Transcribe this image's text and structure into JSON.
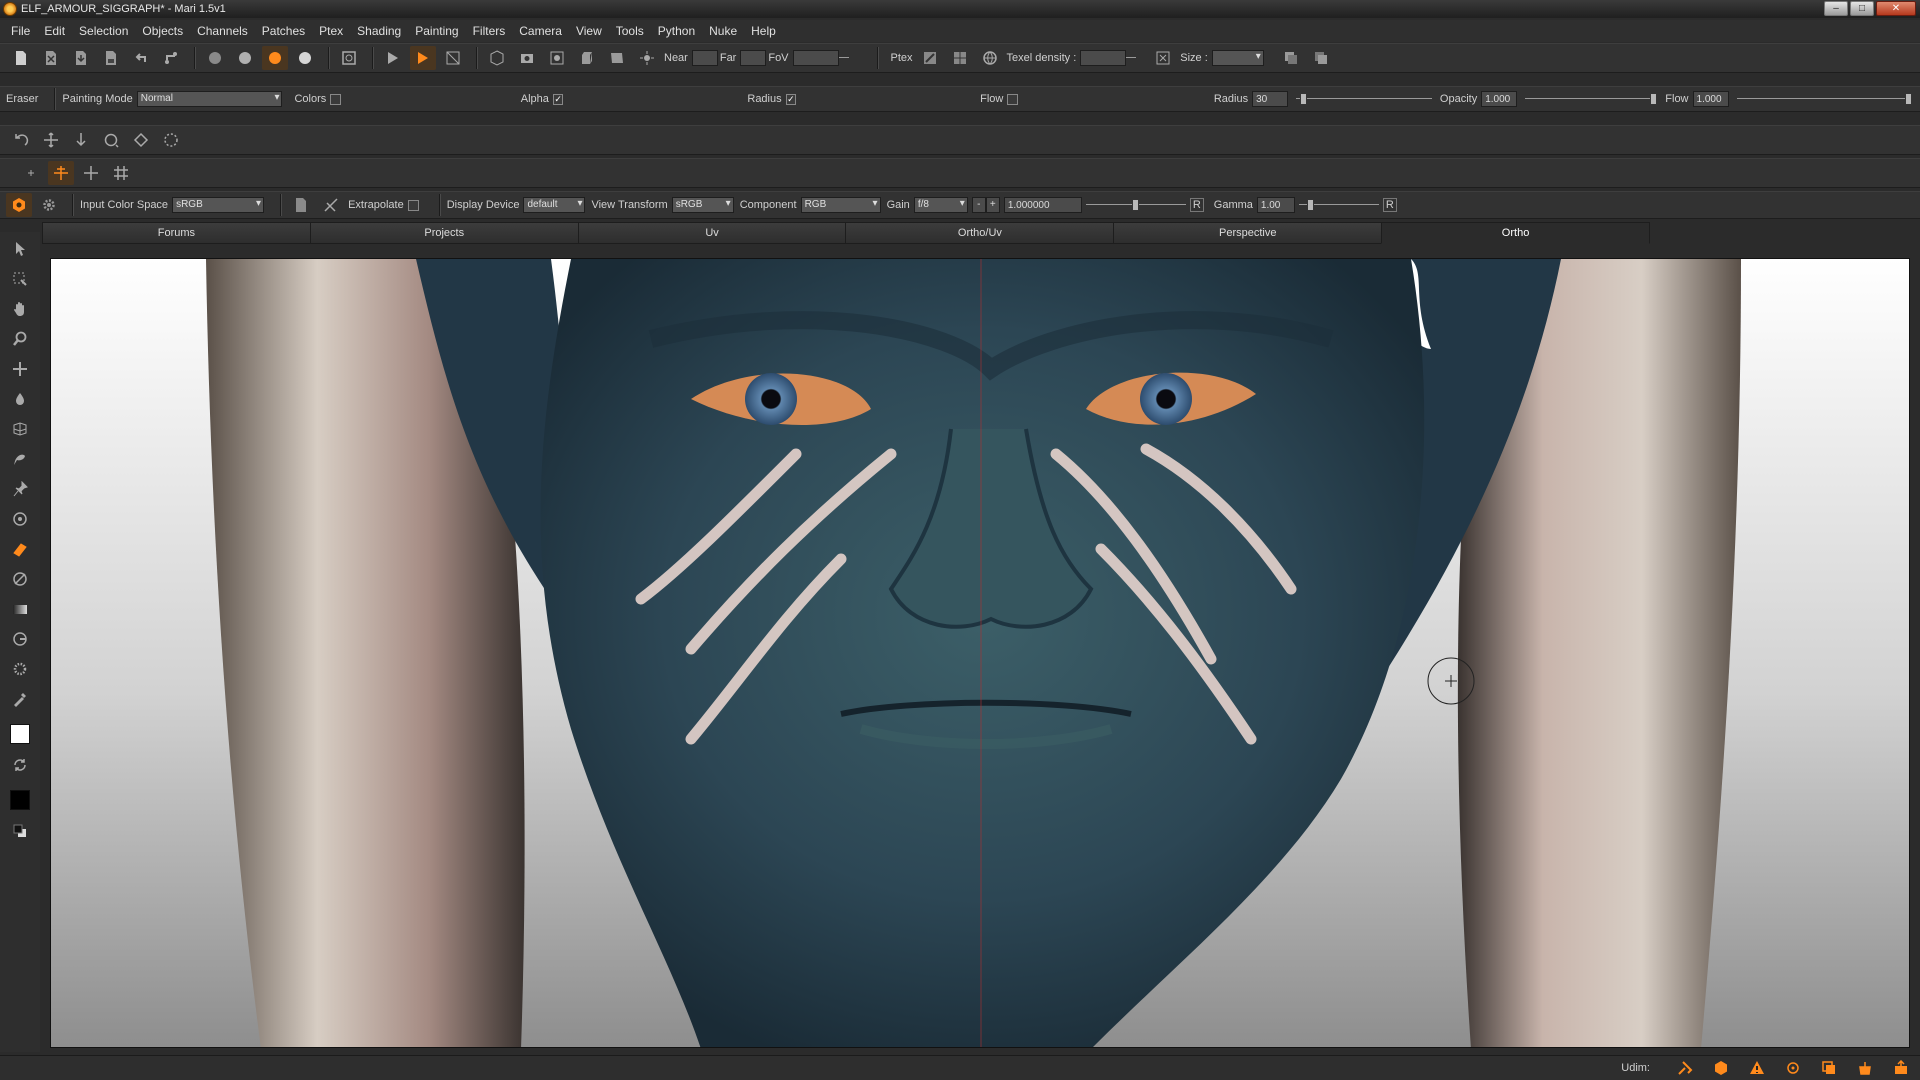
{
  "window": {
    "title": "ELF_ARMOUR_SIGGRAPH* - Mari 1.5v1",
    "min": "‒",
    "max": "□",
    "close": "✕"
  },
  "menu": [
    "File",
    "Edit",
    "Selection",
    "Objects",
    "Channels",
    "Patches",
    "Ptex",
    "Shading",
    "Painting",
    "Filters",
    "Camera",
    "View",
    "Tools",
    "Python",
    "Nuke",
    "Help"
  ],
  "camera": {
    "near_label": "Near",
    "far_label": "Far",
    "fov_label": "FoV"
  },
  "ptex": {
    "label": "Ptex",
    "texel_density_label": "Texel density :",
    "size_label": "Size :"
  },
  "brush": {
    "tool_label": "Eraser",
    "painting_mode_label": "Painting Mode",
    "painting_mode_value": "Normal",
    "colors_label": "Colors",
    "alpha_label": "Alpha",
    "radius_check_label": "Radius",
    "flow_check_label": "Flow",
    "radius_label": "Radius",
    "radius_value": "30",
    "opacity_label": "Opacity",
    "opacity_value": "1.000",
    "flow_label": "Flow",
    "flow_value": "1.000"
  },
  "color": {
    "input_color_space_label": "Input Color Space",
    "input_color_space_value": "sRGB",
    "extrapolate_label": "Extrapolate",
    "display_device_label": "Display Device",
    "display_device_value": "default",
    "view_transform_label": "View Transform",
    "view_transform_value": "sRGB",
    "component_label": "Component",
    "component_value": "RGB",
    "gain_label": "Gain",
    "gain_value": "f/8",
    "gain_minus": "-",
    "gain_plus": "+",
    "gain_number": "1.000000",
    "reset_label": "R",
    "gamma_label": "Gamma",
    "gamma_value": "1.00"
  },
  "tabs": [
    "Forums",
    "Projects",
    "Uv",
    "Ortho/Uv",
    "Perspective",
    "Ortho"
  ],
  "status": {
    "udim_label": "Udim:"
  },
  "colors": {
    "accent": "#ff8a1c",
    "skin": "#2c4654",
    "stripe": "#e6d3cd"
  }
}
